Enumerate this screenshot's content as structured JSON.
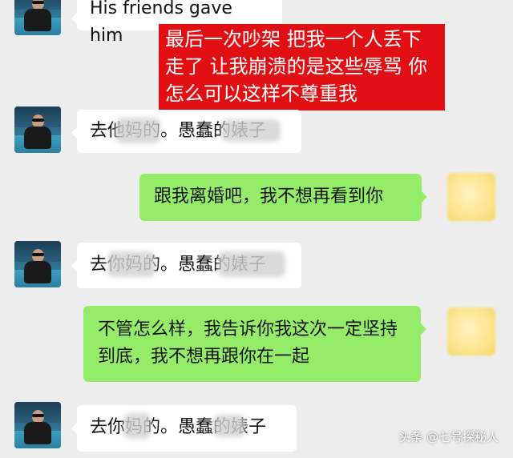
{
  "messages": [
    {
      "text": "His friends gave him"
    },
    {
      "text": "去他妈的。愚蠢的婊子"
    },
    {
      "text": "跟我离婚吧，我不想再看到你"
    },
    {
      "text": "去你妈的。愚蠢的婊子"
    },
    {
      "text": "不管怎么样，我告诉你我这次一定坚持到底，我不想再跟你在一起"
    },
    {
      "text": "去你妈的。愚蠢的婊子"
    }
  ],
  "overlay_text": "最后一次吵架 把我一个人丢下走了 让我崩溃的是这些辱骂 你怎么可以这样不尊重我",
  "watermark": "头条 @七号探秘人",
  "colors": {
    "background": "#ededed",
    "incoming_bubble": "#ffffff",
    "outgoing_bubble": "#95ec69",
    "overlay": "#e10f13"
  }
}
